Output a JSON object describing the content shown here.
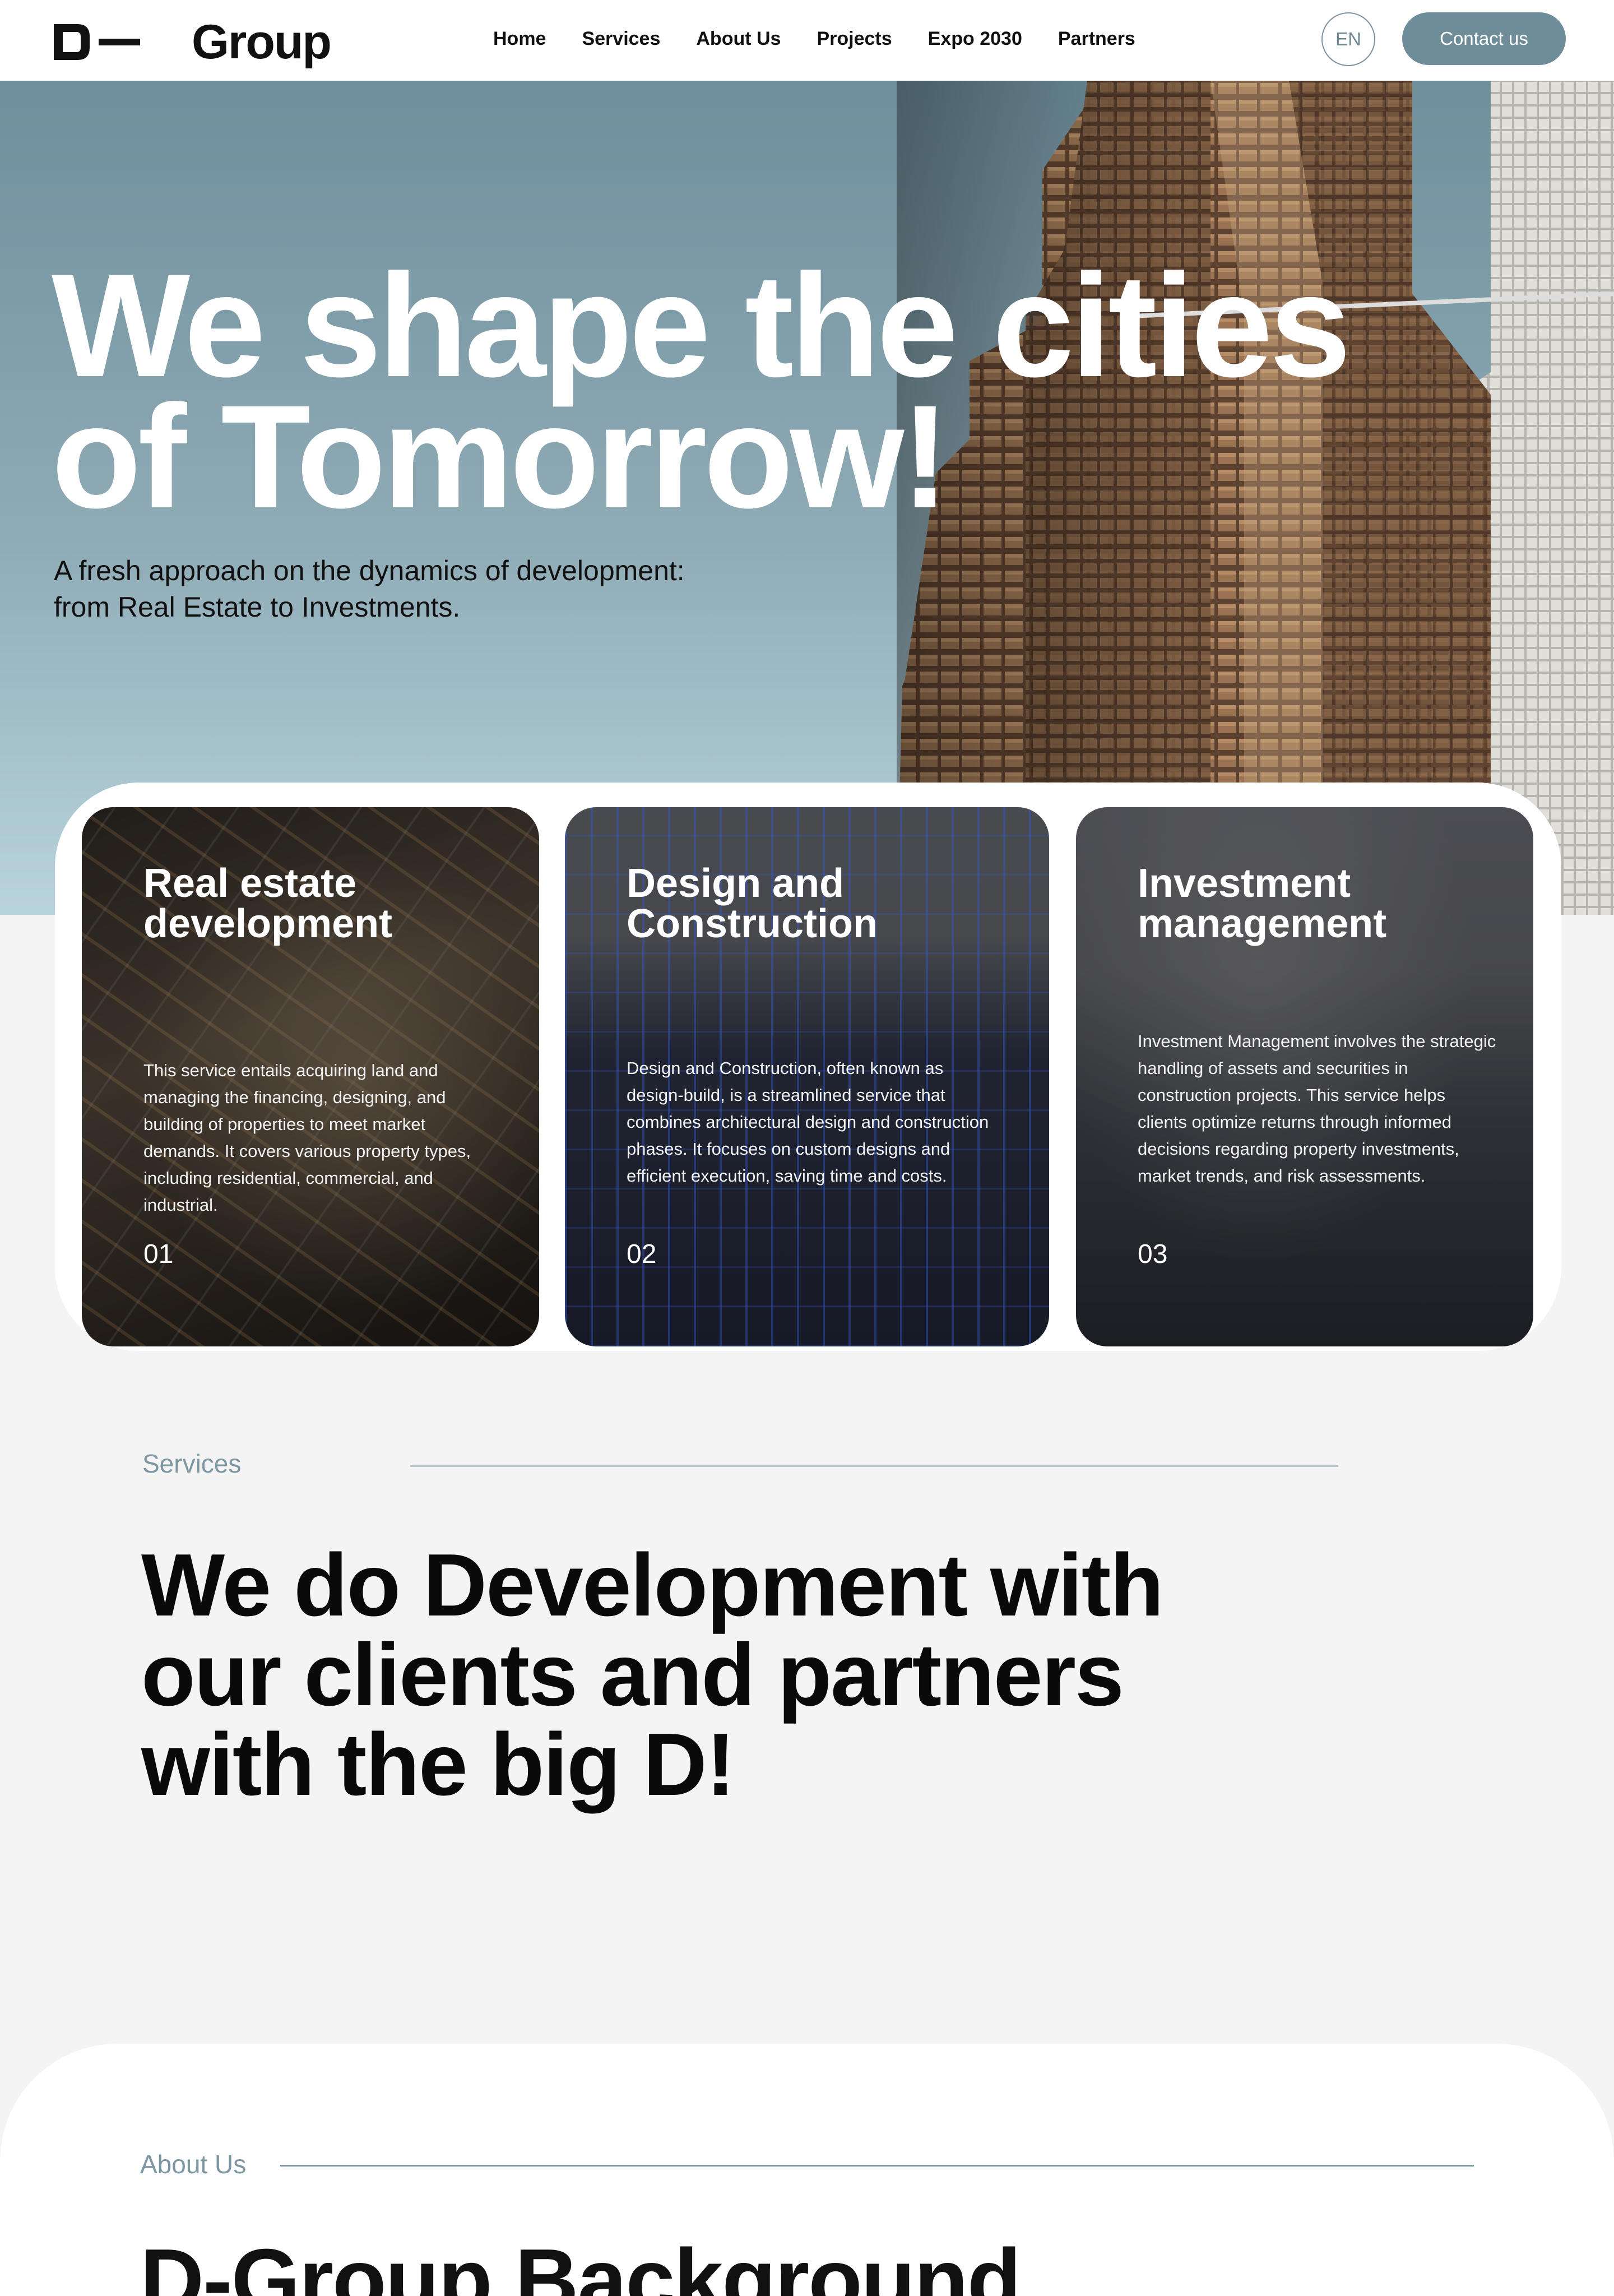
{
  "header": {
    "logo_text": "Group",
    "nav": [
      "Home",
      "Services",
      "About Us",
      "Projects",
      "Expo 2030",
      "Partners"
    ],
    "language": "EN",
    "contact_label": "Contact us"
  },
  "hero": {
    "title_line1": "We shape the cities",
    "title_line2": "of Tomorrow!",
    "subtitle_line1": "A fresh approach on the dynamics of development:",
    "subtitle_line2": "from Real Estate to Investments."
  },
  "cards": [
    {
      "title_line1": "Real estate",
      "title_line2": "development",
      "description": "This service entails acquiring land and managing the financing, designing, and building of properties to meet market demands. It covers various property types, including residential, commercial, and industrial.",
      "number": "01"
    },
    {
      "title_line1": "Design and",
      "title_line2": "Construction",
      "description": "Design and Construction, often known as design-build, is a streamlined service that combines architectural design and construction phases. It focuses on custom designs and efficient execution, saving time and costs.",
      "number": "02"
    },
    {
      "title_line1": "Investment",
      "title_line2": "management",
      "description": "Investment Management involves the strategic handling of assets and securities in construction projects. This service helps clients optimize returns through informed decisions regarding property investments, market trends, and risk assessments.",
      "number": "03"
    }
  ],
  "services_section": {
    "label": "Services",
    "heading_line1": "We do Development with",
    "heading_line2": "our clients and partners",
    "heading_line3": "with the big D!"
  },
  "about_section": {
    "label": "About Us",
    "heading": "D-Group Background"
  },
  "colors": {
    "accent": "#6f8c99",
    "label": "#7c96a2",
    "hero_sky": "#8fabb6"
  }
}
